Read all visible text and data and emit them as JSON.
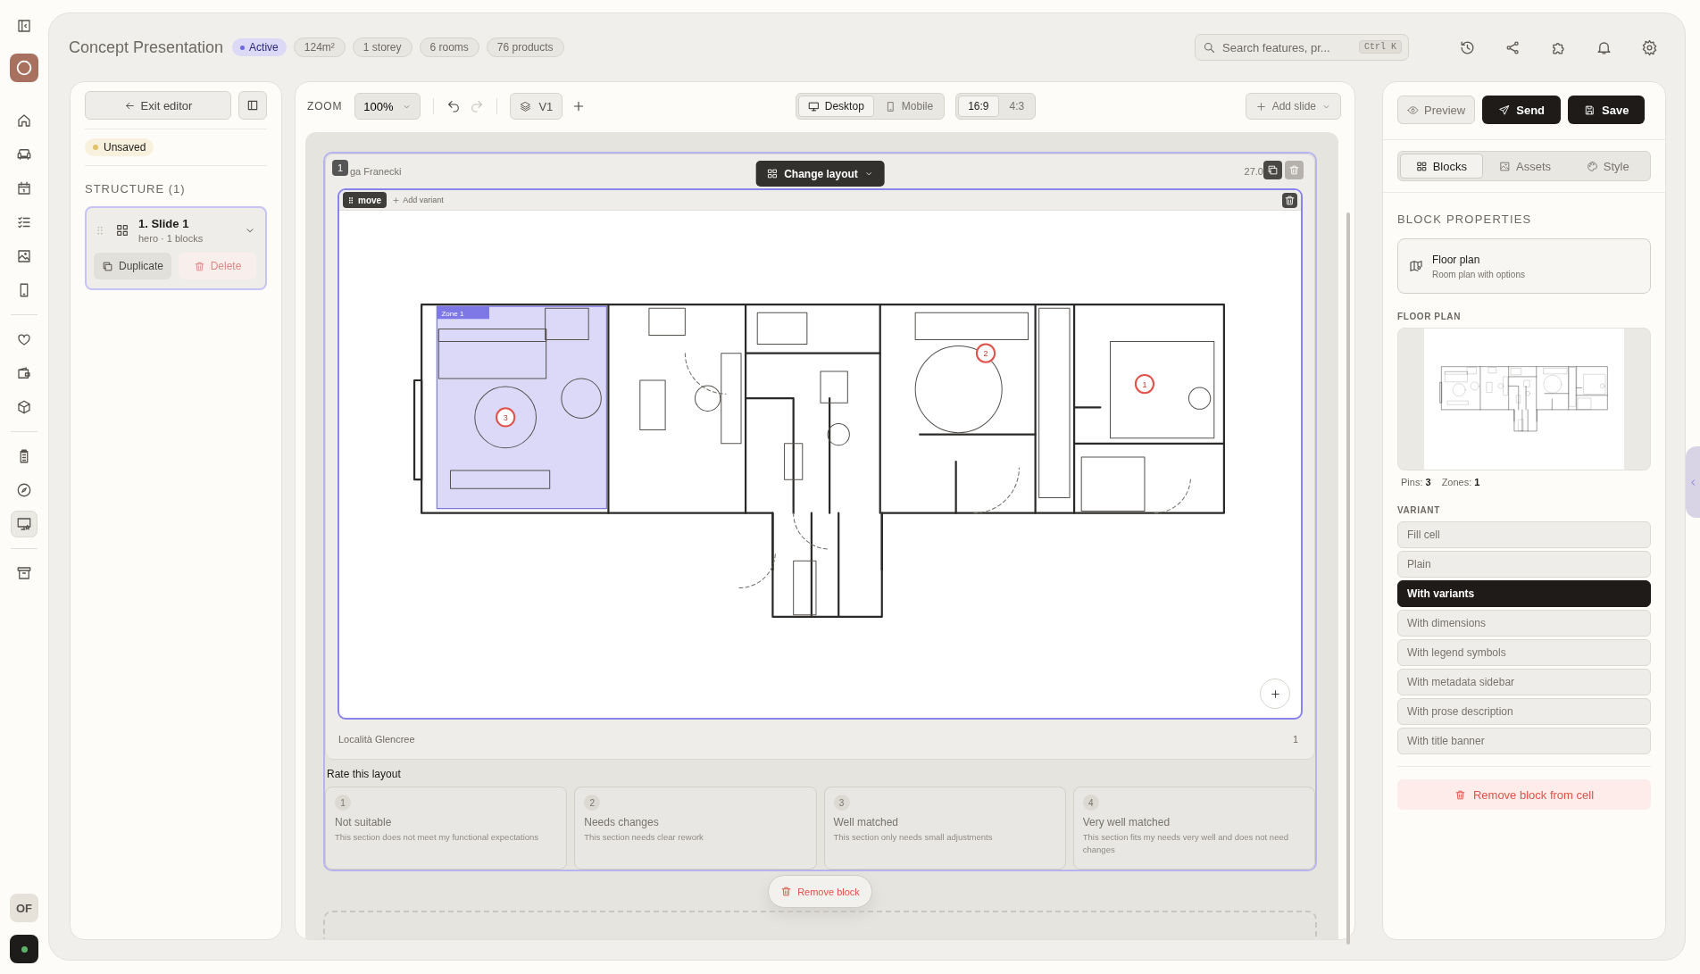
{
  "rail": {
    "groups": [
      [
        {
          "selected": false
        },
        {
          "selected": false
        },
        {
          "selected": false
        },
        {
          "selected": false
        },
        {
          "selected": false
        },
        {
          "selected": false
        }
      ],
      [
        {
          "selected": false
        },
        {
          "selected": false
        },
        {
          "selected": false
        }
      ],
      [
        {
          "selected": false
        },
        {
          "selected": false
        },
        {
          "selected": true
        }
      ],
      [
        {
          "selected": false
        }
      ]
    ],
    "avatar": "OF"
  },
  "header": {
    "title": "Concept Presentation",
    "status": "Active",
    "chips": [
      "124m²",
      "1 storey",
      "6 rooms",
      "76 products"
    ],
    "search": {
      "placeholder": "Search features, pr...",
      "shortcut": "Ctrl K"
    }
  },
  "left_panel": {
    "exit": "Exit editor",
    "save_state": "Unsaved",
    "structure_title": "STRUCTURE (1)",
    "slides": [
      {
        "title": "1. Slide 1",
        "meta": "hero · 1 blocks",
        "selected": true,
        "duplicate": "Duplicate",
        "delete": "Delete",
        "delete_disabled": true
      }
    ]
  },
  "toolbar": {
    "zoom_label": "ZOOM",
    "zoom": "100%",
    "version": "V1",
    "devices": [
      {
        "label": "Desktop",
        "selected": true
      },
      {
        "label": "Mobile",
        "selected": false
      }
    ],
    "ratios": [
      {
        "label": "16:9",
        "selected": true
      },
      {
        "label": "4:3",
        "selected": false
      }
    ],
    "add_slide": "Add slide"
  },
  "slide": {
    "number": "1",
    "author": "ga Franecki",
    "date": "27.0",
    "change_layout": "Change layout",
    "block": {
      "move": "move",
      "add_variant": "Add variant",
      "zone": "Zone 1",
      "pins": [
        "1",
        "2",
        "3"
      ]
    },
    "location": "Località Glencree",
    "page": "1"
  },
  "rating": {
    "title": "Rate this layout",
    "options": [
      {
        "number": "1",
        "title": "Not suitable",
        "description": "This section does not meet my functional expectations",
        "selected": false
      },
      {
        "number": "2",
        "title": "Needs changes",
        "description": "This section needs clear rework",
        "selected": false
      },
      {
        "number": "3",
        "title": "Well matched",
        "description": "This section only needs small adjustments",
        "selected": false
      },
      {
        "number": "4",
        "title": "Very well matched",
        "description": "This section fits my needs very well and does not need changes",
        "selected": false
      }
    ]
  },
  "remove_block": "Remove block",
  "right_panel": {
    "preview": "Preview",
    "send": "Send",
    "save": "Save",
    "tabs": [
      {
        "label": "Blocks",
        "selected": true
      },
      {
        "label": "Assets",
        "selected": false
      },
      {
        "label": "Style",
        "selected": false
      }
    ],
    "section": "BLOCK PROPERTIES",
    "block": {
      "title": "Floor plan",
      "subtitle": "Room plan with options"
    },
    "floor_plan_label": "FLOOR PLAN",
    "pins_label": "Pins:",
    "pins": "3",
    "zones_label": "Zones:",
    "zones": "1",
    "variant_label": "VARIANT",
    "variants": [
      {
        "label": "Fill cell",
        "selected": false
      },
      {
        "label": "Plain",
        "selected": false
      },
      {
        "label": "With variants",
        "selected": true
      },
      {
        "label": "With dimensions",
        "selected": false
      },
      {
        "label": "With legend symbols",
        "selected": false
      },
      {
        "label": "With metadata sidebar",
        "selected": false
      },
      {
        "label": "With prose description",
        "selected": false
      },
      {
        "label": "With title banner",
        "selected": false
      }
    ],
    "remove": "Remove block from cell"
  }
}
